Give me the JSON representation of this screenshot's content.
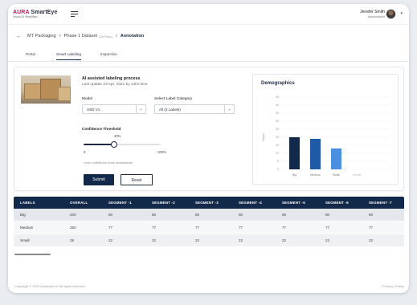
{
  "brand": {
    "name_a": "AURA ",
    "name_b": "SmartEye",
    "tagline": "Vision AI Simplified",
    "color": "#c2185b"
  },
  "user": {
    "name": "Jenefer Smith",
    "role": "Administrator"
  },
  "breadcrumb": {
    "items": [
      "MT Packaging",
      "Phase 1 Dataset",
      "Annotation"
    ],
    "dataset_files": "(36 Files)"
  },
  "tabs": [
    "Portal",
    "Smart Labeling",
    "Inspection"
  ],
  "active_tab": "Smart Labeling",
  "process": {
    "title": "AI assisted labeling process",
    "meta": "Last update 23 Apr, 2021  by John Doe"
  },
  "form": {
    "model_label": "Model",
    "model_value": "SSD V1",
    "category_label": "Select Label Category",
    "category_value": "All (3 Labels)",
    "threshold_title": "Confidence Threshold",
    "threshold_value": "40%",
    "threshold_level": 0.4,
    "threshold_min": "0",
    "threshold_max": "100%",
    "hint": "Less confidence more annotations",
    "submit_label": "Submit",
    "reset_label": "Reset"
  },
  "chart_data": {
    "type": "bar",
    "title": "Demographics",
    "ylabel": "Height",
    "categories": [
      "Big",
      "Medium",
      "Small",
      "Invalid"
    ],
    "values": [
      20,
      19,
      13,
      0
    ],
    "colors": [
      "#12294a",
      "#1f5aa6",
      "#4a8fe0",
      "#cccccc"
    ],
    "yticks": [
      0,
      5,
      10,
      15,
      20,
      25,
      30,
      35,
      40,
      45
    ],
    "ylim": [
      0,
      45
    ],
    "grid": true
  },
  "table": {
    "headers": [
      "LABELS",
      "OVERALL",
      "SEGMENT -1",
      "SEGMENT -2",
      "SEGMENT -3",
      "SEGMENT -4",
      "SEGMENT -5",
      "SEGMENT -6",
      "SEGMENT -7"
    ],
    "rows": [
      [
        "Big",
        "200",
        "80",
        "80",
        "80",
        "80",
        "80",
        "80",
        "80"
      ],
      [
        "Medium",
        "250",
        "77",
        "77",
        "77",
        "77",
        "77",
        "77",
        "77"
      ],
      [
        "Small",
        "29",
        "22",
        "22",
        "22",
        "22",
        "22",
        "22",
        "22"
      ]
    ]
  },
  "footer": {
    "copyright": "Copyright © 2022 Auraeade.ai. All rights reserved.",
    "links": "Privacy | Policy"
  }
}
